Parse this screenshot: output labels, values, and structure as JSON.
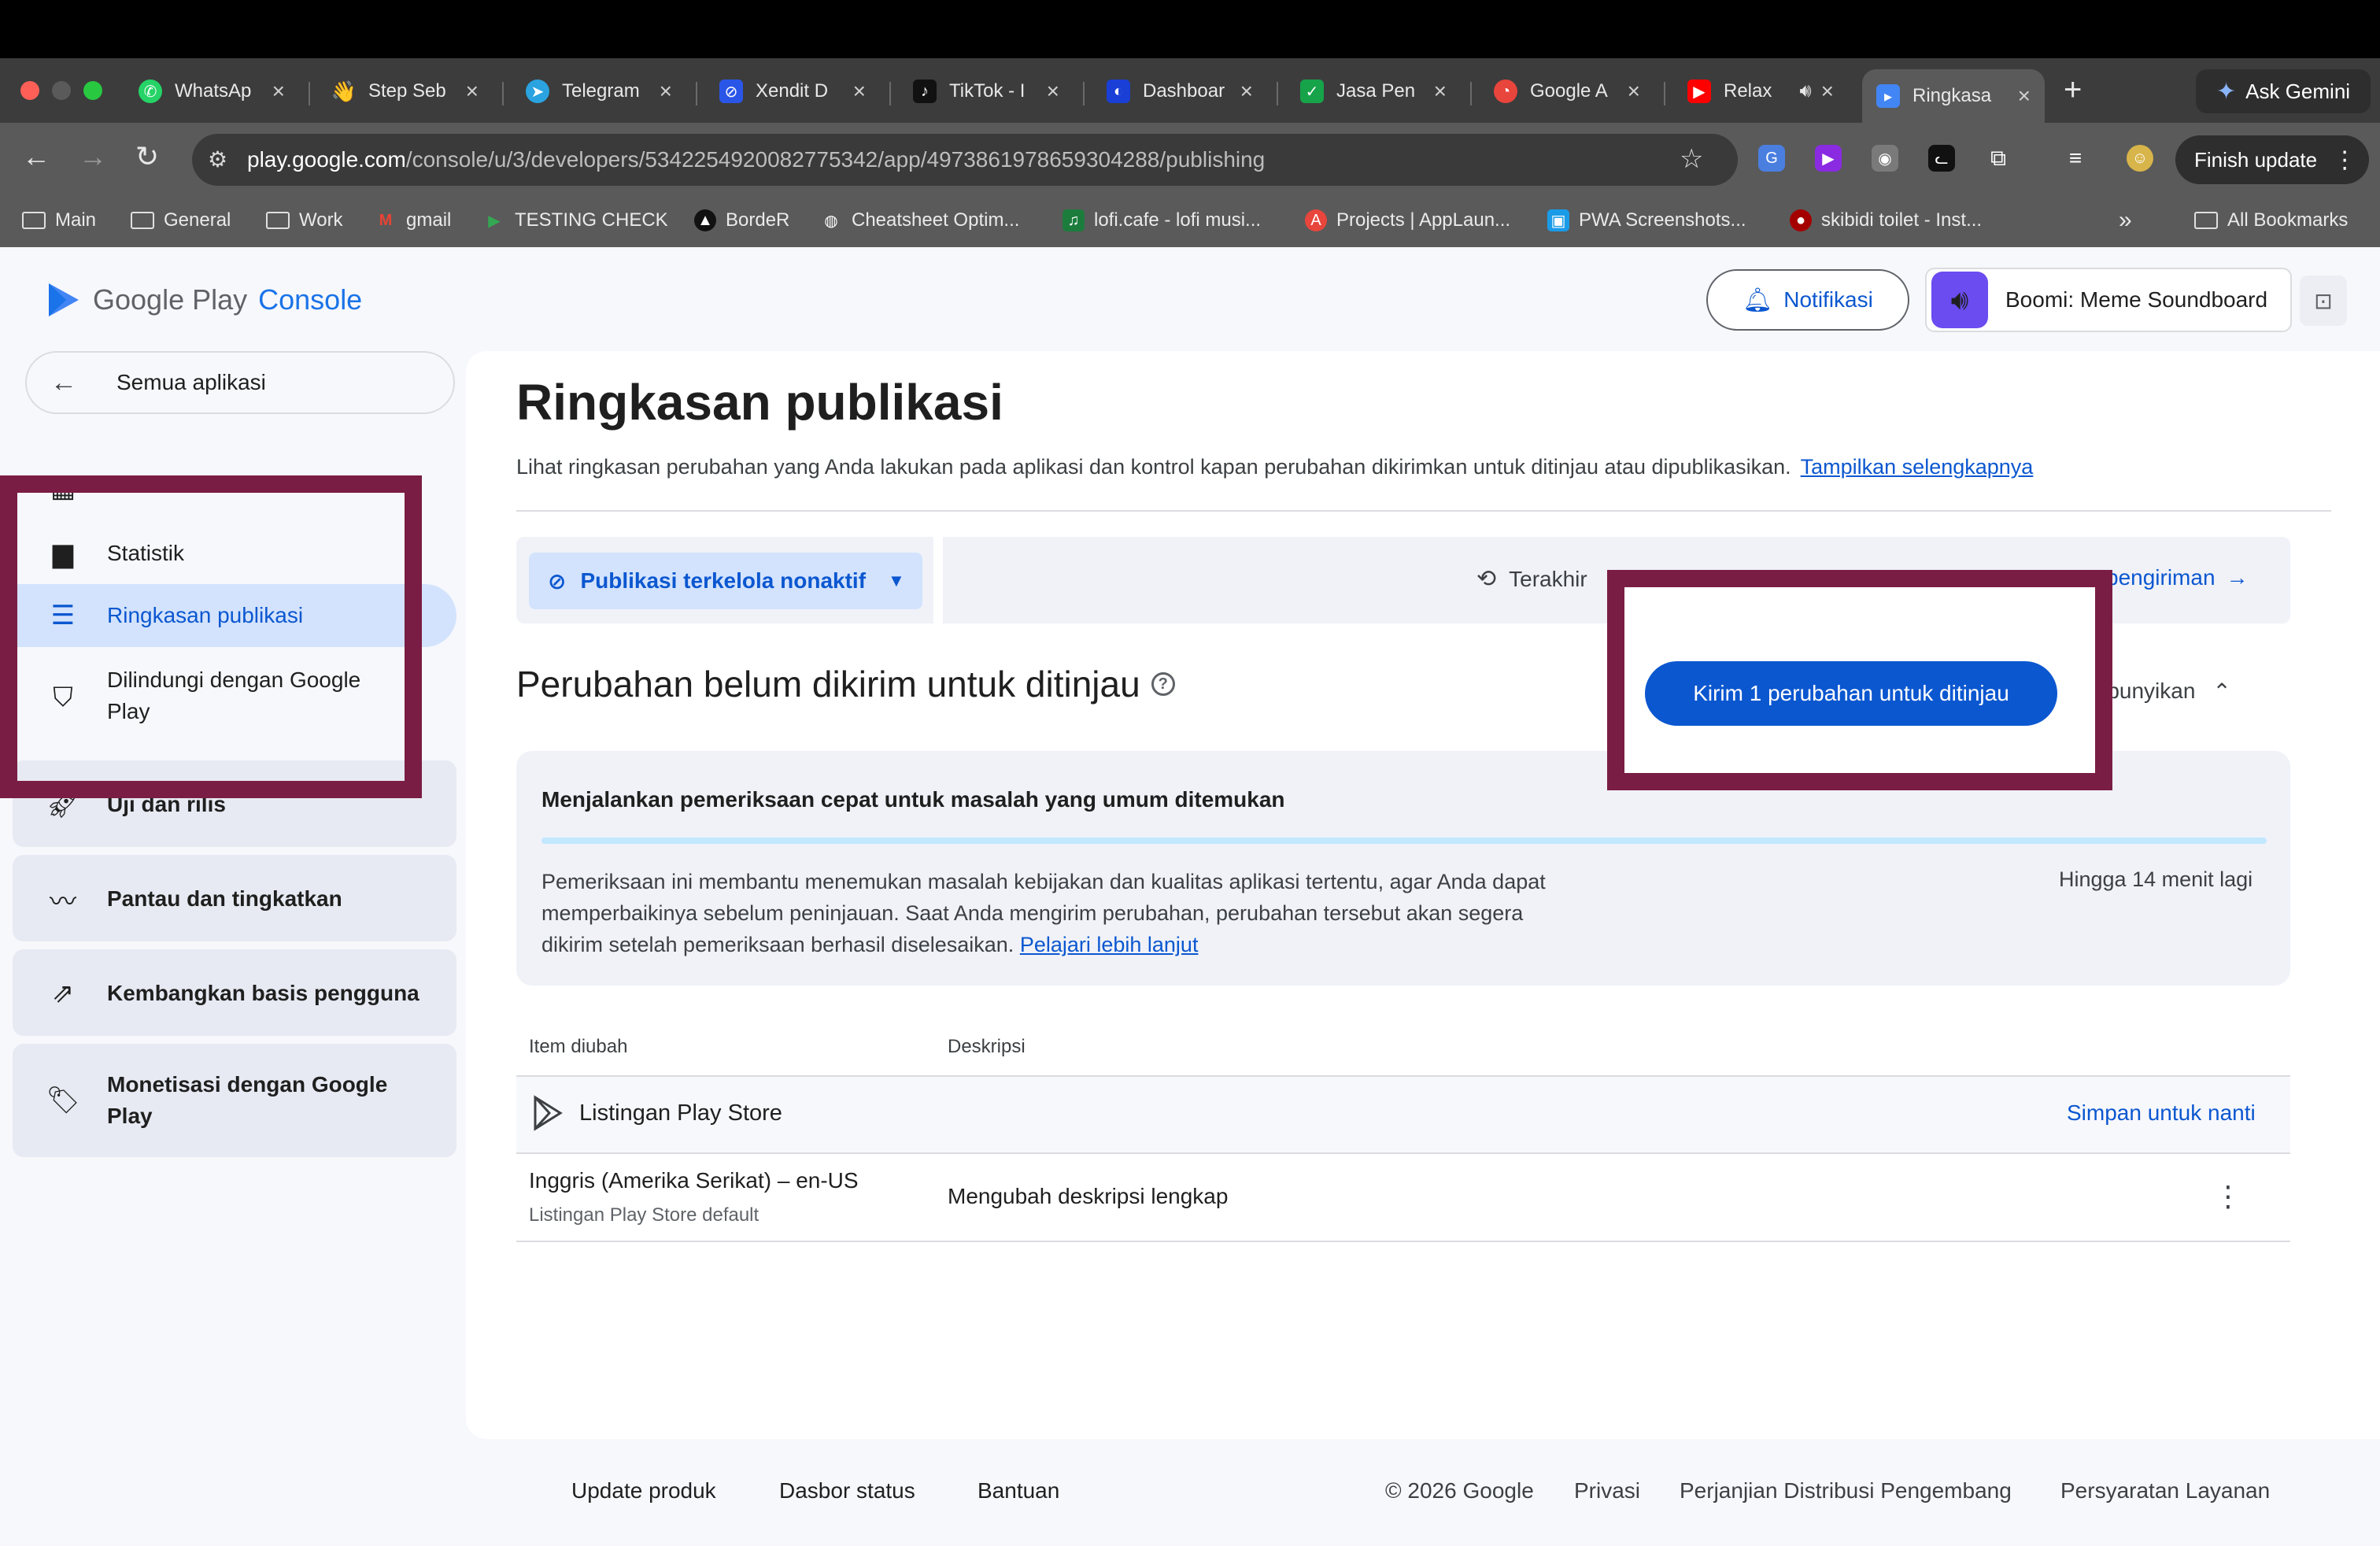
{
  "browser": {
    "tabs": [
      {
        "title": "WhatsAp",
        "icon": "whatsapp-icon",
        "color": "#25d366"
      },
      {
        "title": "Step Seb",
        "icon": "wave-hand-icon",
        "color": "#d9a44a"
      },
      {
        "title": "Telegram",
        "icon": "telegram-icon",
        "color": "#2aa3e0"
      },
      {
        "title": "Xendit D",
        "icon": "xendit-icon",
        "color": "#2a56e8"
      },
      {
        "title": "TikTok - I",
        "icon": "tiktok-icon",
        "color": "#111111"
      },
      {
        "title": "Dashboar",
        "icon": "dashboard-icon",
        "color": "#1a3fd6"
      },
      {
        "title": "Jasa Pen",
        "icon": "check-app-icon",
        "color": "#17a34a"
      },
      {
        "title": "Google A",
        "icon": "google-ads-icon",
        "color": "#e8453c"
      },
      {
        "title": "Relax",
        "icon": "youtube-icon",
        "color": "#ff0000"
      },
      {
        "title": "Ringkasa",
        "icon": "play-console-icon",
        "color": "#4285f4",
        "active": true
      }
    ],
    "new_tab": "+",
    "ask_gemini": "Ask Gemini",
    "url_host": "play.google.com",
    "url_path": "/console/u/3/developers/5342254920082775342/app/4973861978659304288/publishing",
    "finish_update": "Finish update",
    "bookmarks": [
      {
        "label": "Main",
        "icon": "folder-icon"
      },
      {
        "label": "General",
        "icon": "folder-icon"
      },
      {
        "label": "Work",
        "icon": "folder-icon"
      },
      {
        "label": "gmail",
        "icon": "gmail-icon"
      },
      {
        "label": "TESTING CHECK",
        "icon": "play-store-icon"
      },
      {
        "label": "BordeR",
        "icon": "triangle-logo-icon"
      },
      {
        "label": "Cheatsheet Optim...",
        "icon": "globe-icon"
      },
      {
        "label": "lofi.cafe - lofi musi...",
        "icon": "lofi-icon"
      },
      {
        "label": "Projects | AppLaun...",
        "icon": "applaunch-icon"
      },
      {
        "label": "PWA Screenshots...",
        "icon": "pwa-icon"
      },
      {
        "label": "skibidi toilet - Inst...",
        "icon": "red-circle-icon"
      }
    ],
    "bookmarks_more": "»",
    "all_bookmarks": "All Bookmarks"
  },
  "header": {
    "logo_google": "Google Play",
    "logo_console": "Console",
    "notif_label": "Notifikasi",
    "app_name": "Boomi: Meme Soundboard"
  },
  "sidebar": {
    "back_label": "Semua aplikasi",
    "items": [
      {
        "label": "Statistik",
        "icon": "bar-chart-icon"
      },
      {
        "label": "Ringkasan publikasi",
        "icon": "publishing-icon",
        "active": true
      },
      {
        "label": "Dilindungi dengan Google Play",
        "icon": "shield-icon"
      }
    ],
    "groups": [
      {
        "label": "Uji dan rilis",
        "icon": "rocket-icon"
      },
      {
        "label": "Pantau dan tingkatkan",
        "icon": "pulse-icon"
      },
      {
        "label": "Kembangkan basis pengguna",
        "icon": "growth-icon"
      },
      {
        "label": "Monetisasi dengan Google Play",
        "icon": "tag-icon"
      }
    ]
  },
  "main": {
    "title": "Ringkasan publikasi",
    "lead": "Lihat ringkasan perubahan yang Anda lakukan pada aplikasi dan kontrol kapan perubahan dikirimkan untuk ditinjau atau dipublikasikan.",
    "lead_link": "Tampilkan selengkapnya",
    "managed_pub": "Publikasi terkelola nonaktif",
    "last_sent_visible": "Terakhir",
    "history_visible": "pengiriman",
    "section_title": "Perubahan belum dikirim untuk ditinjau",
    "send_button": "Kirim 1 perubahan untuk ditinjau",
    "hide_visible": "mbunyikan",
    "check": {
      "title": "Menjalankan pemeriksaan cepat untuk masalah yang umum ditemukan",
      "body": "Pemeriksaan ini membantu menemukan masalah kebijakan dan kualitas aplikasi tertentu, agar Anda dapat memperbaikinya sebelum peninjauan. Saat Anda mengirim perubahan, perubahan tersebut akan segera dikirim setelah pemeriksaan berhasil diselesaikan.",
      "link": "Pelajari lebih lanjut",
      "eta": "Hingga 14 menit lagi"
    },
    "table": {
      "col_item": "Item diubah",
      "col_desc": "Deskripsi",
      "group": "Listingan Play Store",
      "save_later": "Simpan untuk nanti",
      "row_title": "Inggris (Amerika Serikat) – en-US",
      "row_sub": "Listingan Play Store default",
      "row_desc": "Mengubah deskripsi lengkap"
    }
  },
  "footer": {
    "links": [
      "Update produk",
      "Dasbor status",
      "Bantuan"
    ],
    "copyright": "© 2026 Google",
    "privacy": "Privasi",
    "dist": "Perjanjian Distribusi Pengembang",
    "terms": "Persyaratan Layanan"
  },
  "colors": {
    "accent": "#0b57d0",
    "annotation": "#7a1d44",
    "active_nav": "#d3e3fd"
  }
}
